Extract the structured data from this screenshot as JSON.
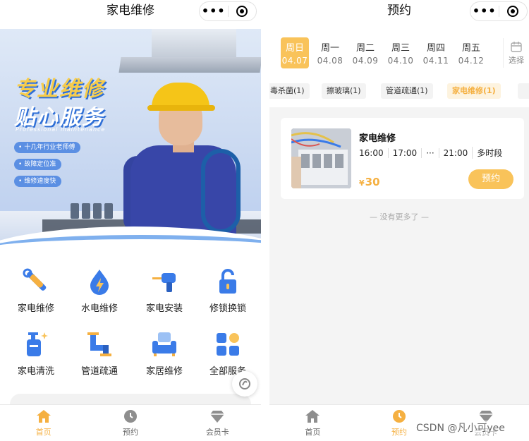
{
  "left": {
    "nav_title": "家电维修",
    "capsule": {
      "more_icon": "more-dots-icon",
      "close_icon": "target-icon"
    },
    "banner": {
      "title_line1": "专业维修",
      "title_line2": "贴心服务",
      "subtitle": "Professional maintenance",
      "points": [
        "十几年行业老师傅",
        "故障定位准",
        "维修速度快"
      ]
    },
    "services": [
      {
        "label": "家电维修",
        "icon": "wrench-screwdriver-icon"
      },
      {
        "label": "水电维修",
        "icon": "water-drop-lightning-icon"
      },
      {
        "label": "家电安装",
        "icon": "drill-icon"
      },
      {
        "label": "修锁换锁",
        "icon": "lock-icon"
      },
      {
        "label": "家电清洗",
        "icon": "spray-bottle-icon"
      },
      {
        "label": "管道疏通",
        "icon": "pipe-icon"
      },
      {
        "label": "家居维修",
        "icon": "sofa-icon"
      },
      {
        "label": "全部服务",
        "icon": "grid-icon"
      }
    ],
    "tabs": [
      {
        "label": "首页",
        "icon": "home-icon",
        "active": true
      },
      {
        "label": "预约",
        "icon": "clock-icon",
        "active": false
      },
      {
        "label": "会员卡",
        "icon": "diamond-icon",
        "active": false
      }
    ]
  },
  "right": {
    "nav_title": "预约",
    "dates": [
      {
        "weekday": "周日",
        "date": "04.07",
        "active": true
      },
      {
        "weekday": "周一",
        "date": "04.08"
      },
      {
        "weekday": "周二",
        "date": "04.09"
      },
      {
        "weekday": "周三",
        "date": "04.10"
      },
      {
        "weekday": "周四",
        "date": "04.11"
      },
      {
        "weekday": "周五",
        "date": "04.12"
      }
    ],
    "choose_label": "选择",
    "categories": [
      "毒杀菌(1)",
      "擦玻璃(1)",
      "管道疏通(1)",
      "家电维修(1)"
    ],
    "active_category": "家电维修(1)",
    "card": {
      "title": "家电维修",
      "slots": [
        "16:00",
        "17:00",
        "···",
        "21:00",
        "多时段"
      ],
      "price_symbol": "¥",
      "price": "30",
      "book_label": "预约"
    },
    "no_more": "— 没有更多了 —",
    "tabs": [
      {
        "label": "首页",
        "icon": "home-icon"
      },
      {
        "label": "预约",
        "icon": "clock-icon",
        "active": true
      },
      {
        "label": "会员卡",
        "icon": "diamond-icon"
      }
    ]
  },
  "watermark": "CSDN @凡小可yee",
  "colors": {
    "accent": "#f9c35a",
    "primary_blue": "#3a7be8"
  }
}
